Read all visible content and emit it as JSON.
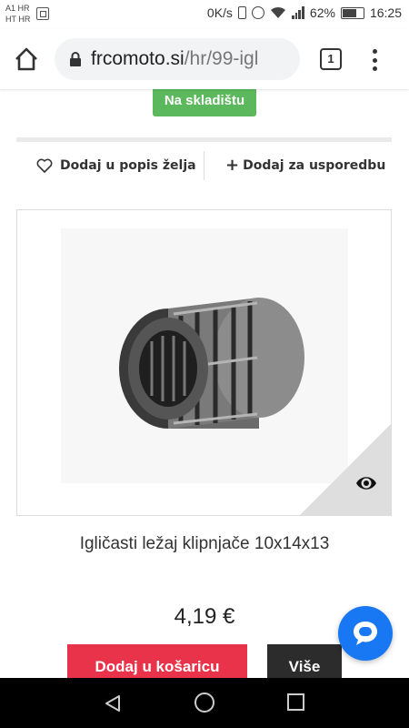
{
  "status_bar": {
    "carrier_line1": "A1 HR",
    "carrier_line2": "HT HR",
    "speed": "0K/s",
    "battery_percent": "62%",
    "time": "16:25",
    "battery_level": 0.62
  },
  "browser": {
    "url_domain": "frcomoto.si",
    "url_path": "/hr/99-igl",
    "tab_count": "1"
  },
  "product": {
    "stock_badge": "Na skladištu",
    "wishlist_label": "Dodaj u popis želja",
    "compare_label": "Dodaj za usporedbu",
    "name": "Igličasti ležaj klipnjače 10x14x13",
    "price": "4,19 €",
    "add_to_cart_label": "Dodaj u košaricu",
    "more_label": "Više"
  },
  "colors": {
    "stock_green": "#5cb85c",
    "cart_red": "#e8334a",
    "more_dark": "#2c2c2c",
    "chat_blue": "#1877f2"
  },
  "icons": {
    "home": "home-icon",
    "lock": "lock-icon",
    "menu": "more-vert-icon",
    "wishlist": "heart-icon",
    "compare": "plus-icon",
    "quickview": "eye-icon",
    "chat": "chat-bubble-icon"
  }
}
